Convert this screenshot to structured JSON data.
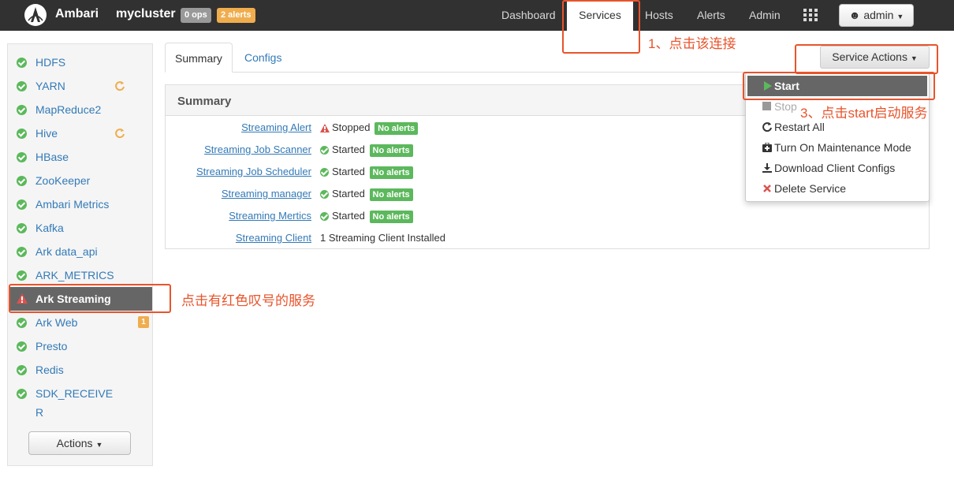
{
  "topbar": {
    "brand": "Ambari",
    "cluster": "mycluster",
    "ops_badge": "0 ops",
    "alerts_badge": "2 alerts",
    "nav": [
      "Dashboard",
      "Services",
      "Hosts",
      "Alerts",
      "Admin"
    ],
    "active_nav": "Services",
    "user": "admin"
  },
  "sidebar": {
    "services": [
      {
        "label": "HDFS",
        "status": "ok"
      },
      {
        "label": "YARN",
        "status": "ok",
        "refresh": true
      },
      {
        "label": "MapReduce2",
        "status": "ok"
      },
      {
        "label": "Hive",
        "status": "ok",
        "refresh": true
      },
      {
        "label": "HBase",
        "status": "ok"
      },
      {
        "label": "ZooKeeper",
        "status": "ok"
      },
      {
        "label": "Ambari Metrics",
        "status": "ok"
      },
      {
        "label": "Kafka",
        "status": "ok"
      },
      {
        "label": "Ark data_api",
        "status": "ok"
      },
      {
        "label": "ARK_METRICS",
        "status": "ok"
      },
      {
        "label": "Ark Streaming",
        "status": "alert",
        "selected": true
      },
      {
        "label": "Ark Web",
        "status": "ok",
        "count": "1"
      },
      {
        "label": "Presto",
        "status": "ok"
      },
      {
        "label": "Redis",
        "status": "ok"
      },
      {
        "label": "SDK_RECEIVE",
        "label2": "R",
        "status": "ok"
      }
    ],
    "actions_label": "Actions"
  },
  "tabs": [
    "Summary",
    "Configs"
  ],
  "service_actions_label": "Service Actions",
  "summary": {
    "title": "Summary",
    "rows": [
      {
        "label": "Streaming Alert",
        "state": "Stopped",
        "icon": "warning",
        "badge": "No alerts"
      },
      {
        "label": "Streaming Job Scanner",
        "state": "Started",
        "icon": "ok",
        "badge": "No alerts"
      },
      {
        "label": "Streaming Job Scheduler",
        "state": "Started",
        "icon": "ok",
        "badge": "No alerts"
      },
      {
        "label": "Streaming manager",
        "state": "Started",
        "icon": "ok",
        "badge": "No alerts"
      },
      {
        "label": "Streaming Mertics",
        "state": "Started",
        "icon": "ok",
        "badge": "No alerts"
      },
      {
        "label": "Streaming Client",
        "state": "1 Streaming Client Installed",
        "icon": "",
        "badge": ""
      }
    ]
  },
  "dropdown": {
    "items": [
      "Start",
      "Stop",
      "Restart All",
      "Turn On Maintenance Mode",
      "Download Client Configs",
      "Delete Service"
    ]
  },
  "annotations": {
    "step1": "1、点击该连接",
    "step3": "3、点击start启动服务",
    "step2": "点击有红色叹号的服务"
  },
  "colors": {
    "topbar": "#313131",
    "link": "#337ab7",
    "ok_green": "#5cb85c",
    "warning_orange": "#f0ad4e",
    "annotation_red": "#e8542c"
  }
}
